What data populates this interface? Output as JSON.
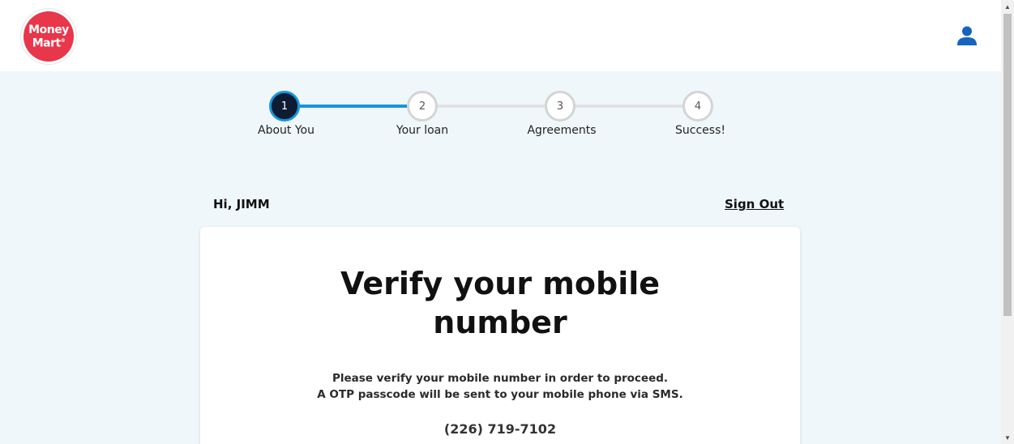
{
  "header": {
    "logo_line1": "Money",
    "logo_line2": "Mart",
    "logo_mark": "®",
    "user_icon": "user-icon"
  },
  "stepper": {
    "steps": [
      {
        "number": "1",
        "label": "About You",
        "active": true
      },
      {
        "number": "2",
        "label": "Your loan",
        "active": false
      },
      {
        "number": "3",
        "label": "Agreements",
        "active": false
      },
      {
        "number": "4",
        "label": "Success!",
        "active": false
      }
    ],
    "active_color": "#1795dc",
    "active_fill": "#0d1b33"
  },
  "session": {
    "greeting": "Hi, JIMM",
    "sign_out": "Sign Out"
  },
  "card": {
    "title_line1": "Verify your mobile",
    "title_line2": "number",
    "desc_line1": "Please verify your mobile number in order to proceed.",
    "desc_line2": "A OTP passcode will be sent to your mobile phone via SMS.",
    "phone": "(226) 719-7102"
  },
  "colors": {
    "brand_red": "#e8364b",
    "page_bg": "#eff7fb",
    "icon_blue": "#1565c0"
  }
}
